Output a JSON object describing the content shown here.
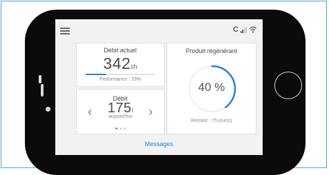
{
  "status": {
    "carrier": "C"
  },
  "flow_card": {
    "title": "Débit actuel",
    "value": "342",
    "unit": "l/h",
    "performance_label": "Performance : 29%",
    "performance_percent": 29
  },
  "daily_card": {
    "title": "Débit",
    "value": "175",
    "unit": "l",
    "period": "aujourd'hui",
    "page_count": 3,
    "active_page": 0
  },
  "regen_card": {
    "title": "Produit régénérant",
    "percent_label": "40 %",
    "percent": 40,
    "remaining": "Restant : 75 jour(s)"
  },
  "footer": {
    "messages_label": "Messages"
  },
  "colors": {
    "accent": "#2a7fd4",
    "card_bg": "#ffffff",
    "screen_bg": "#f2f2f2"
  }
}
